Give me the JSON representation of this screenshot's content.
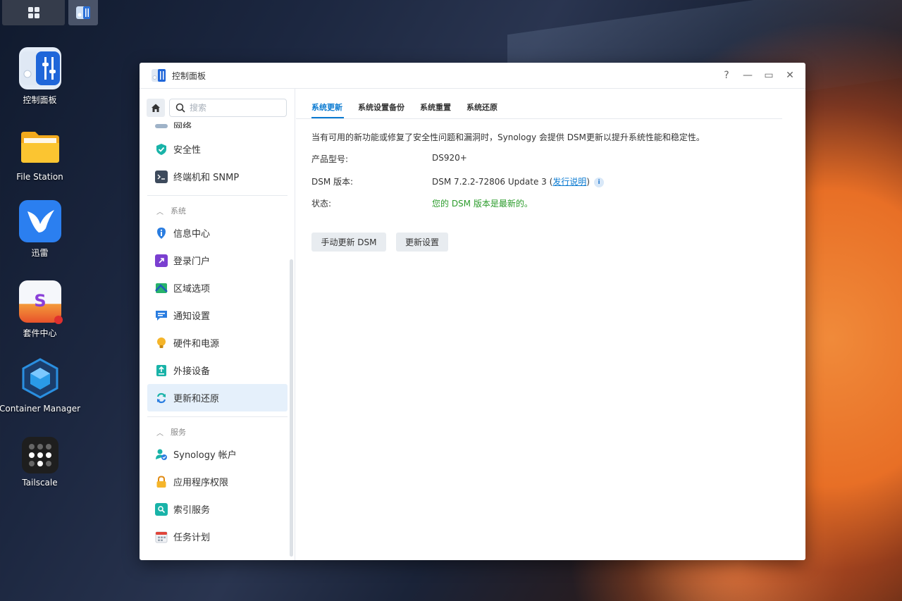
{
  "desktop": {
    "icons": [
      {
        "label": "控制面板"
      },
      {
        "label": "File Station"
      },
      {
        "label": "迅雷"
      },
      {
        "label": "套件中心"
      },
      {
        "label": "Container Manager"
      },
      {
        "label": "Tailscale"
      }
    ]
  },
  "window": {
    "title": "控制面板",
    "controls": {
      "help": "?",
      "minimize": "—",
      "maximize": "▭",
      "close": "✕"
    }
  },
  "sidebar": {
    "search_placeholder": "搜索",
    "partial_item": "网络",
    "items_top": [
      {
        "label": "安全性",
        "icon": "shield-icon"
      },
      {
        "label": "终端机和 SNMP",
        "icon": "terminal-icon"
      }
    ],
    "section_system": "系统",
    "items_system": [
      {
        "label": "信息中心",
        "icon": "info-icon"
      },
      {
        "label": "登录门户",
        "icon": "login-portal-icon"
      },
      {
        "label": "区域选项",
        "icon": "region-icon"
      },
      {
        "label": "通知设置",
        "icon": "notification-icon"
      },
      {
        "label": "硬件和电源",
        "icon": "bulb-icon"
      },
      {
        "label": "外接设备",
        "icon": "external-device-icon"
      },
      {
        "label": "更新和还原",
        "icon": "update-icon"
      }
    ],
    "section_services": "服务",
    "items_services": [
      {
        "label": "Synology 帐户",
        "icon": "account-icon"
      },
      {
        "label": "应用程序权限",
        "icon": "lock-icon"
      },
      {
        "label": "索引服务",
        "icon": "index-icon"
      },
      {
        "label": "任务计划",
        "icon": "calendar-icon"
      }
    ]
  },
  "content": {
    "tabs": [
      "系统更新",
      "系统设置备份",
      "系统重置",
      "系统还原"
    ],
    "description": "当有可用的新功能或修复了安全性问题和漏洞时，Synology 会提供 DSM更新以提升系统性能和稳定性。",
    "model_label": "产品型号:",
    "model_value": "DS920+",
    "dsm_label": "DSM 版本:",
    "dsm_value_prefix": "DSM 7.2.2-72806 Update 3 (",
    "dsm_link": "发行说明",
    "dsm_value_suffix": ")",
    "status_label": "状态:",
    "status_value": "您的 DSM 版本是最新的。",
    "manual_update_button": "手动更新 DSM",
    "update_settings_button": "更新设置"
  },
  "colors": {
    "accent": "#0a7ad1",
    "ok": "#2a9b2a"
  }
}
